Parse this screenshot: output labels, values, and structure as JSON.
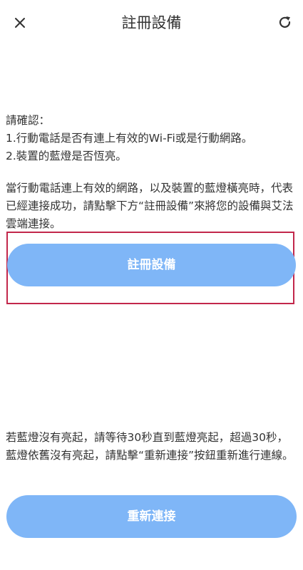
{
  "header": {
    "title": "註冊設備",
    "close_icon": "close-icon",
    "refresh_icon": "refresh-icon"
  },
  "instructions": {
    "heading": "請確認：",
    "item1": "1.行動電話是否有連上有效的Wi-Fi或是行動網路。",
    "item2": "2.裝置的藍燈是否恆亮。",
    "paragraph": "當行動電話連上有效的網路，以及裝置的藍燈橫亮時，代表已經連接成功，請點擊下方“註冊設備”來將您的設備與艾法雲端連接。"
  },
  "register_button": {
    "label": "註冊設備"
  },
  "retry_note": "若藍燈沒有亮起，請等待30秒直到藍燈亮起，超過30秒，藍燈依舊沒有亮起，請點擊“重新連接”按鈕重新進行連線。",
  "reconnect_button": {
    "label": "重新連接"
  },
  "colors": {
    "button": "#7fb6f7",
    "highlight_border": "#c2274b",
    "text": "#333333"
  }
}
